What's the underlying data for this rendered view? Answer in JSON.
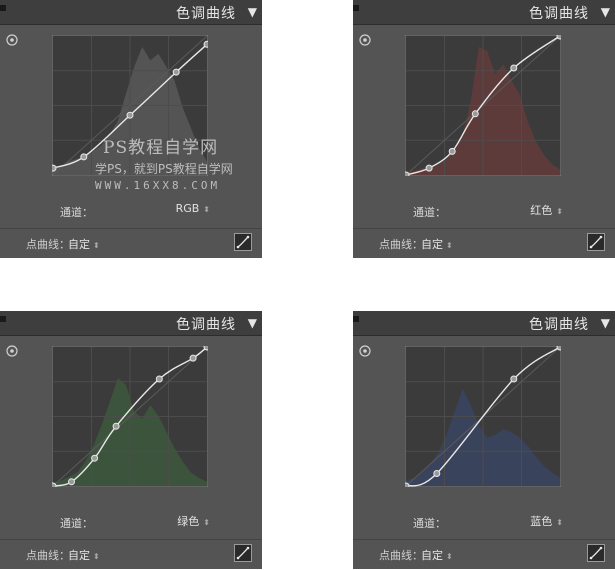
{
  "panels": [
    {
      "title": "色调曲线",
      "channel_label": "通道：",
      "channel_value": "RGB",
      "point_curve_label": "点曲线：",
      "point_curve_value": "自定",
      "histogram_color": "#6a6a6a",
      "points": [
        [
          0,
          0.05
        ],
        [
          0.2,
          0.13
        ],
        [
          0.5,
          0.43
        ],
        [
          0.8,
          0.74
        ],
        [
          1,
          0.94
        ]
      ]
    },
    {
      "title": "色调曲线",
      "channel_label": "通道：",
      "channel_value": "红色",
      "point_curve_label": "点曲线：",
      "point_curve_value": "自定",
      "histogram_color": "#7a3c3c",
      "points": [
        [
          0,
          0
        ],
        [
          0.15,
          0.05
        ],
        [
          0.3,
          0.17
        ],
        [
          0.45,
          0.44
        ],
        [
          0.7,
          0.77
        ],
        [
          1,
          1
        ]
      ]
    },
    {
      "title": "色调曲线",
      "channel_label": "通道：",
      "channel_value": "绿色",
      "point_curve_label": "点曲线：",
      "point_curve_value": "自定",
      "histogram_color": "#3e6a3e",
      "points": [
        [
          0,
          0
        ],
        [
          0.12,
          0.03
        ],
        [
          0.27,
          0.2
        ],
        [
          0.41,
          0.43
        ],
        [
          0.69,
          0.77
        ],
        [
          0.91,
          0.92
        ],
        [
          1,
          1
        ]
      ]
    },
    {
      "title": "色调曲线",
      "channel_label": "通道：",
      "channel_value": "蓝色",
      "point_curve_label": "点曲线：",
      "point_curve_value": "自定",
      "histogram_color": "#3a4a78",
      "points": [
        [
          0,
          0
        ],
        [
          0.2,
          0.09
        ],
        [
          0.7,
          0.77
        ],
        [
          1,
          1
        ]
      ]
    }
  ],
  "watermark": {
    "title": "PS教程自学网",
    "subtitle": "学PS，就到PS教程自学网",
    "url": "WWW.16XX8.COM"
  }
}
